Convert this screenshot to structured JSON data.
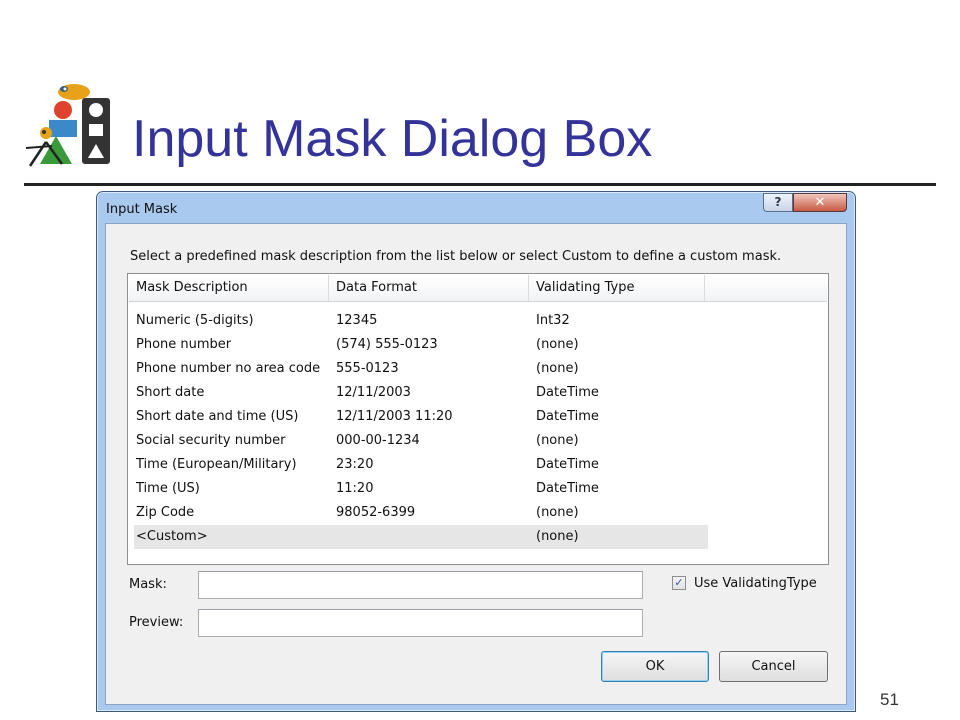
{
  "slide": {
    "title": "Input Mask Dialog Box",
    "page_number": "51"
  },
  "dialog": {
    "title": "Input Mask",
    "help_button": "?",
    "close_button": "✕",
    "instruction": "Select a predefined mask description from the list below or select Custom to define a custom mask.",
    "columns": [
      "Mask Description",
      "Data Format",
      "Validating Type"
    ],
    "rows": [
      {
        "description": "Numeric (5-digits)",
        "format": "12345",
        "type": "Int32"
      },
      {
        "description": "Phone number",
        "format": "(574) 555-0123",
        "type": "(none)"
      },
      {
        "description": "Phone number no area code",
        "format": "555-0123",
        "type": "(none)"
      },
      {
        "description": "Short date",
        "format": "12/11/2003",
        "type": "DateTime"
      },
      {
        "description": "Short date and time (US)",
        "format": "12/11/2003 11:20",
        "type": "DateTime"
      },
      {
        "description": "Social security number",
        "format": "000-00-1234",
        "type": "(none)"
      },
      {
        "description": "Time (European/Military)",
        "format": "23:20",
        "type": "DateTime"
      },
      {
        "description": "Time (US)",
        "format": "11:20",
        "type": "DateTime"
      },
      {
        "description": "Zip Code",
        "format": "98052-6399",
        "type": "(none)"
      },
      {
        "description": "<Custom>",
        "format": "",
        "type": "(none)"
      }
    ],
    "selected_row": "<Custom>",
    "mask_label": "Mask:",
    "mask_value": "",
    "preview_label": "Preview:",
    "preview_value": "",
    "use_validating_type_label": "Use ValidatingType",
    "use_validating_type_checked": true,
    "ok_label": "OK",
    "cancel_label": "Cancel"
  },
  "colors": {
    "title_text": "#33339a",
    "window_frame": "#a9c9ee",
    "dialog_background": "#f0f0f0"
  },
  "icons": {
    "logo": "shapes-figures-logo-icon",
    "help": "help-icon",
    "close": "close-icon",
    "check": "checkmark-icon"
  }
}
